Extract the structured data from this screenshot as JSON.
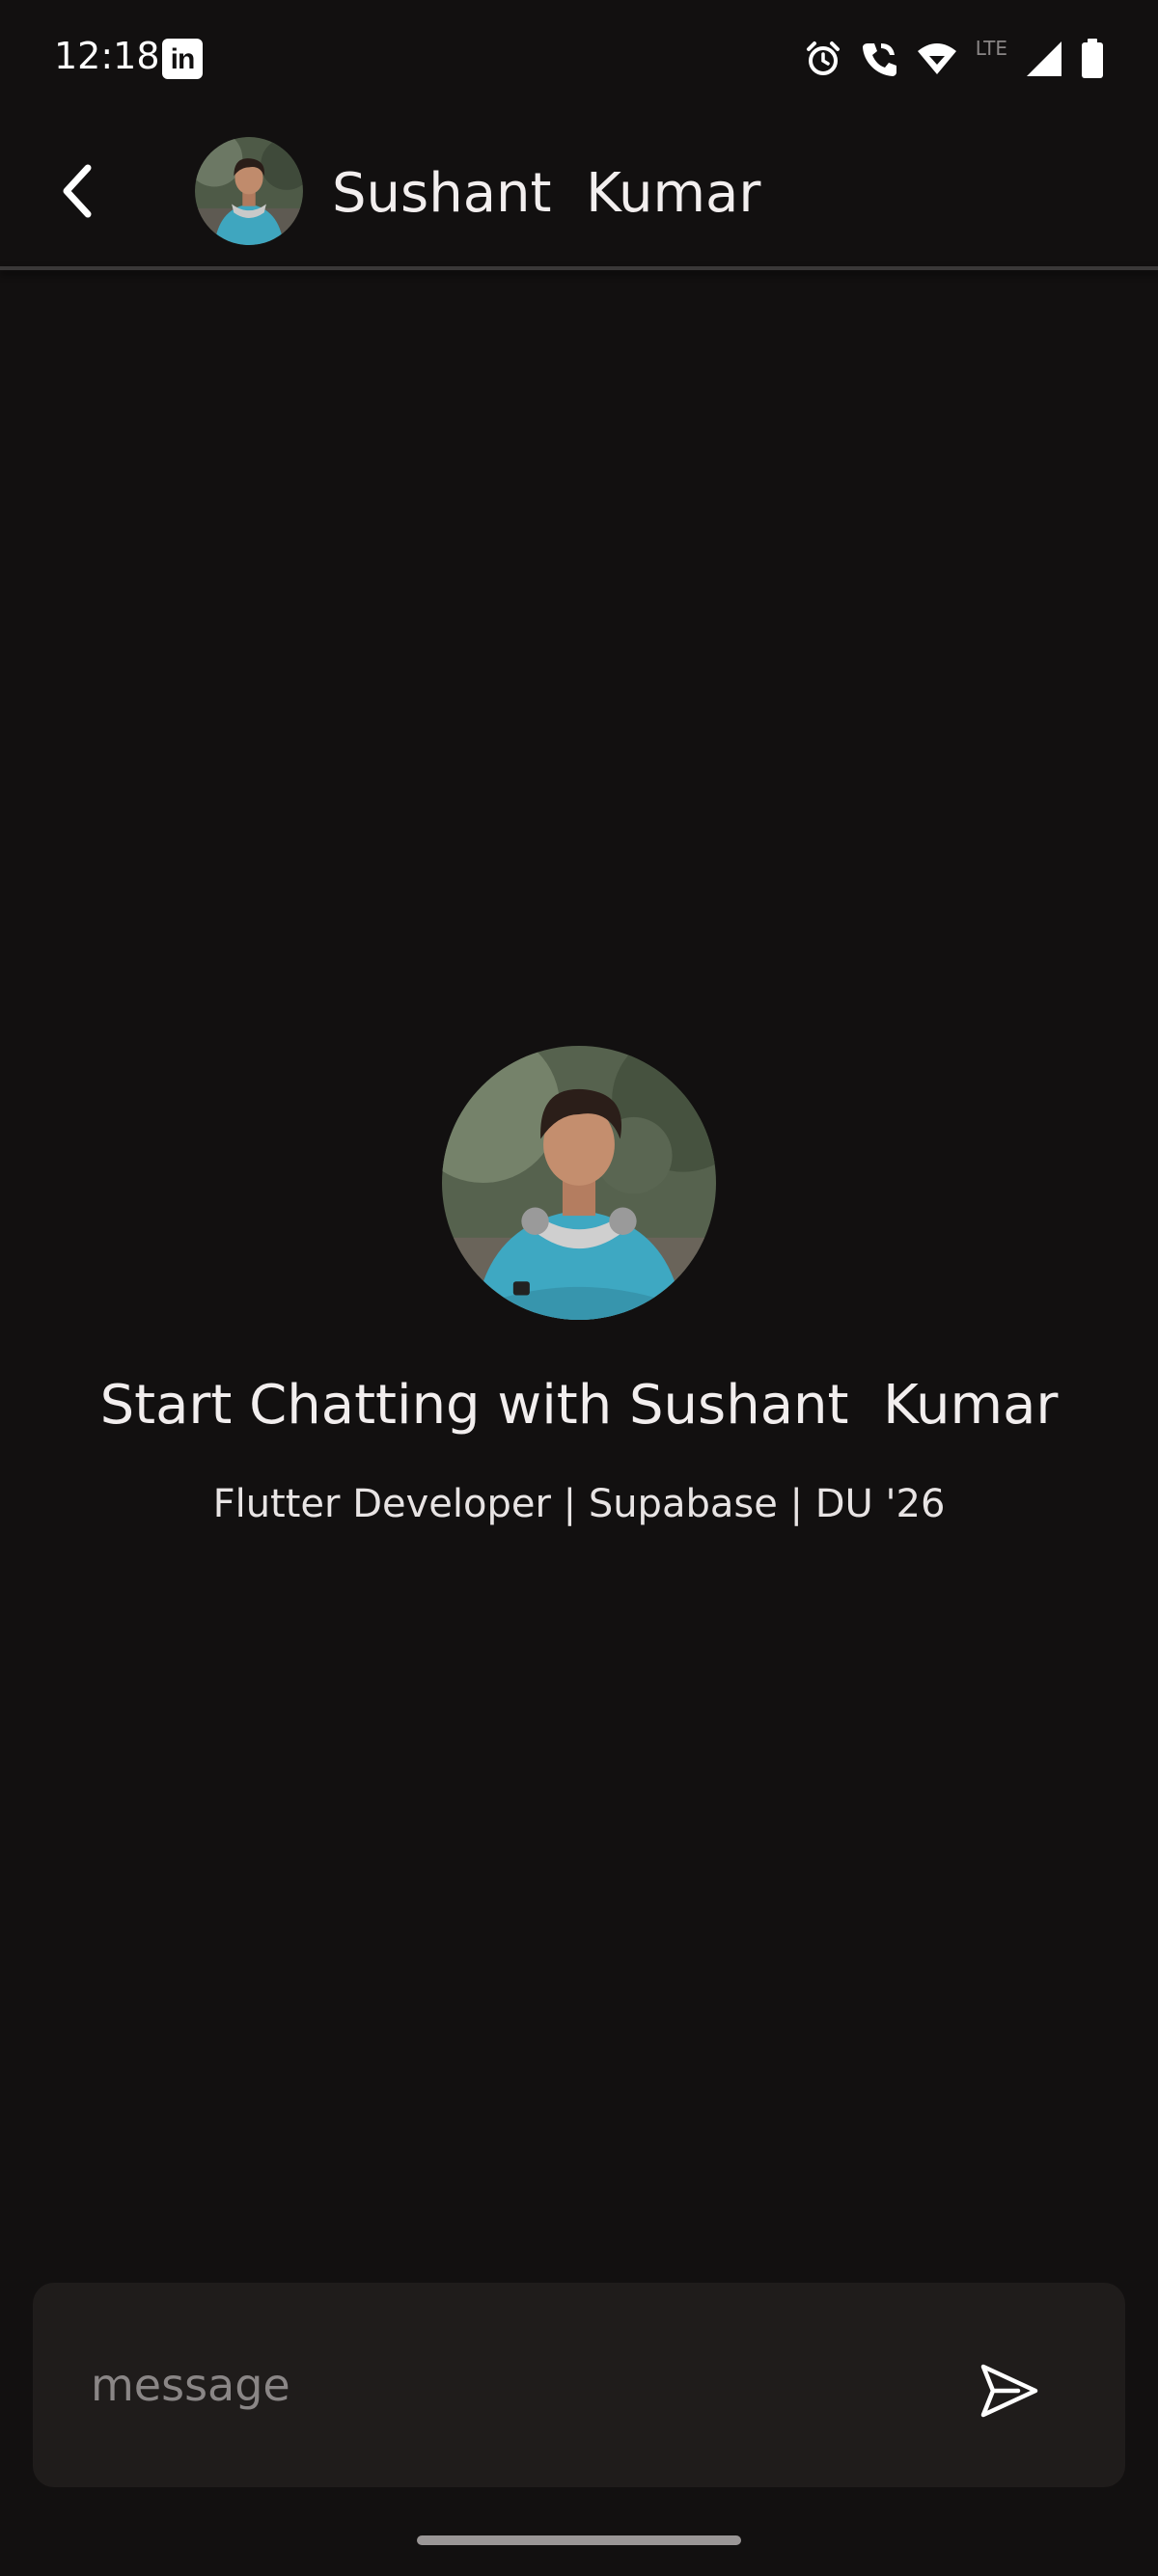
{
  "status_bar": {
    "time": "12:18",
    "linkedin_label": "in",
    "network_label": "LTE"
  },
  "header": {
    "contact_name": "Sushant  Kumar"
  },
  "empty_state": {
    "title": "Start Chatting with Sushant  Kumar",
    "bio": "Flutter Developer | Supabase | DU '26"
  },
  "composer": {
    "placeholder": "message",
    "value": ""
  },
  "colors": {
    "background": "#121010",
    "composer_background": "#1f1c1b",
    "text": "#f2eeee",
    "placeholder": "#8a8686"
  },
  "icons": [
    "linkedin-icon",
    "alarm-icon",
    "wifi-calling-icon",
    "wifi-icon",
    "signal-icon",
    "battery-icon",
    "back-arrow-icon",
    "send-icon"
  ]
}
